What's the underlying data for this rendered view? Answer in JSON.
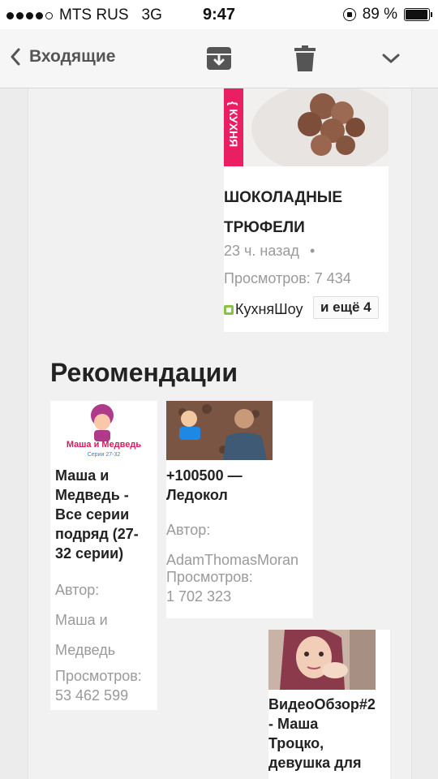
{
  "status_bar": {
    "carrier": "MTS RUS",
    "network": "3G",
    "time": "9:47",
    "battery": "89 %",
    "battery_level": 0.89
  },
  "nav": {
    "back_label": "Входящие",
    "icons": [
      "archive-icon",
      "trash-icon",
      "chevron-down-icon"
    ]
  },
  "featured": {
    "badge": "{ КУХНЯ",
    "title_line1": "ШОКОЛАДНЫЕ",
    "title_line2": "ТРЮФЕЛИ",
    "time": "23 ч. назад",
    "separator": "•",
    "views": "Просмотров: 7 434",
    "channel": "КухняШоу",
    "more": "и ещё 4"
  },
  "recommendations": {
    "heading": "Рекомендации",
    "items": [
      {
        "title_lines": [
          "Маша и",
          "Медведь -",
          "Все серии",
          "подряд (27-",
          "32 серии)"
        ],
        "author_label": "Автор:",
        "author_lines": [
          "Маша и",
          "Медведь"
        ],
        "views_label": "Просмотров:",
        "views_value": "53 462 599",
        "thumb_logo": "Маша и Медведь",
        "thumb_sub": "Серии 27-32"
      },
      {
        "title_lines": [
          "+100500 —",
          "Ледокол"
        ],
        "author_label": "Автор:",
        "author": "AdamThomasMoran",
        "views_label": "Просмотров:",
        "views_value": "1 702 323"
      },
      {
        "title_lines": [
          "ВидеоОбзор#2",
          "- Маша",
          "Троцко,",
          "девушка для"
        ]
      }
    ]
  }
}
